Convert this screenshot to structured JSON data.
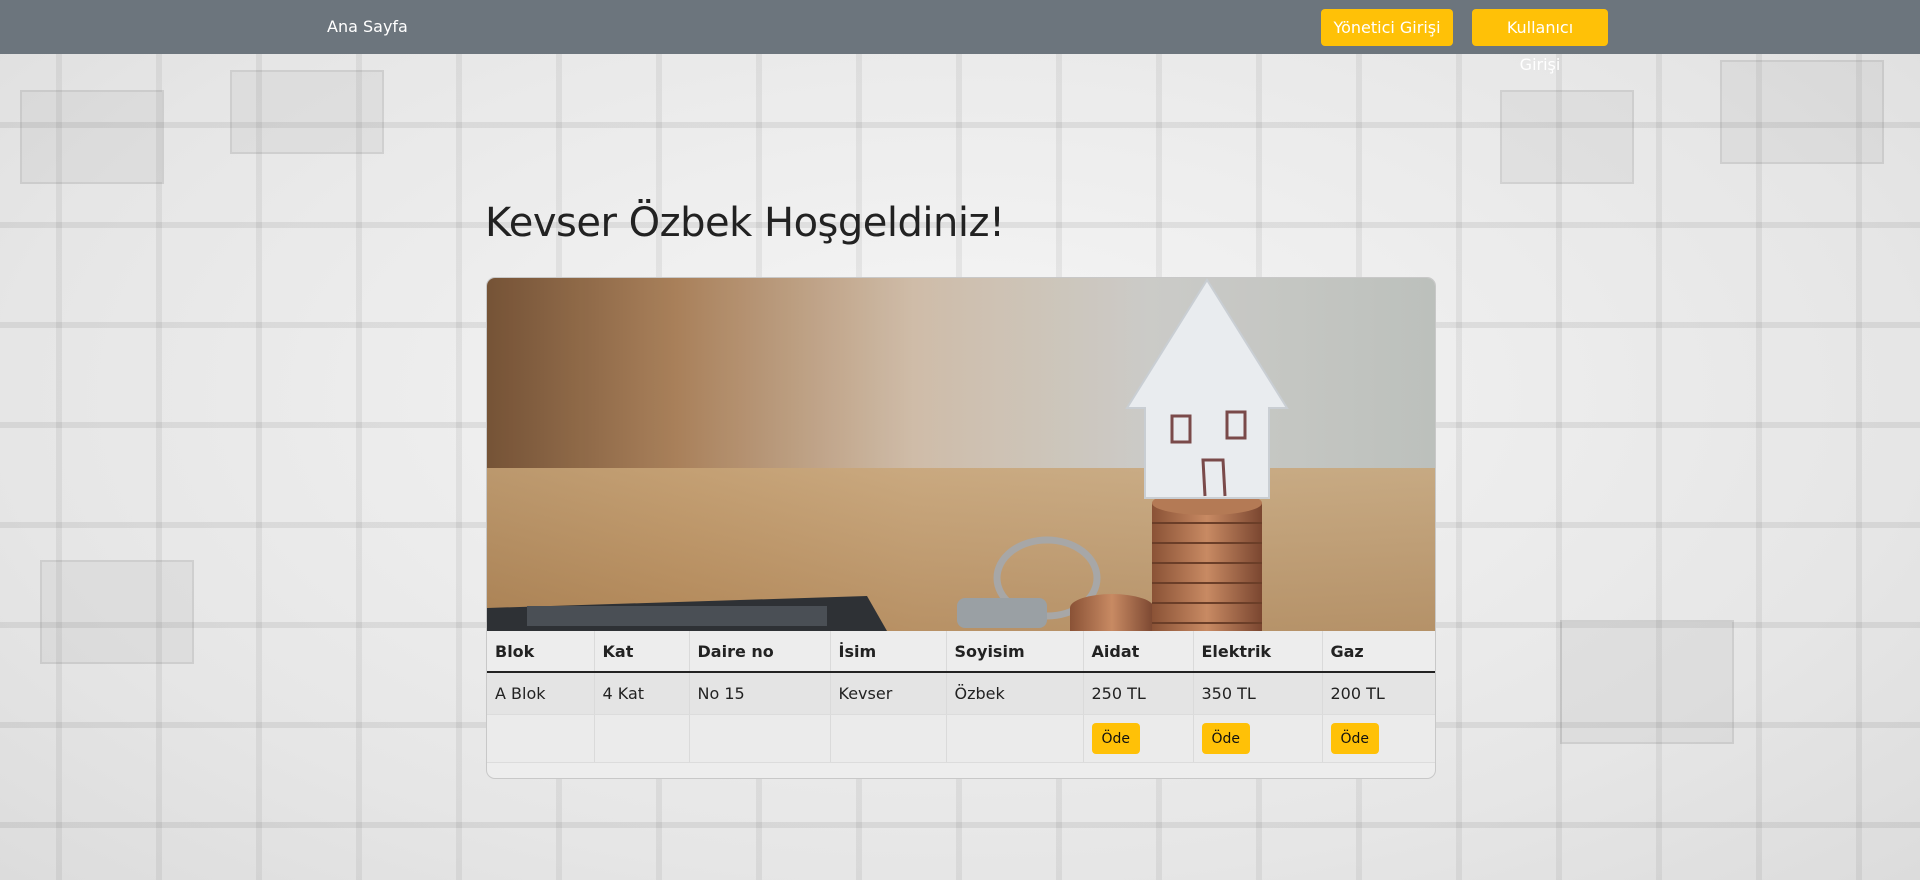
{
  "nav": {
    "home": "Ana Sayfa",
    "admin_login": "Yönetici Girişi",
    "user_login": "Kullanıcı Girişi"
  },
  "welcome": "Kevser Özbek Hoşgeldiniz!",
  "table": {
    "headers": [
      "Blok",
      "Kat",
      "Daire no",
      "İsim",
      "Soyisim",
      "Aidat",
      "Elektrik",
      "Gaz"
    ],
    "row": [
      "A Blok",
      "4 Kat",
      "No 15",
      "Kevser",
      "Özbek",
      "250 TL",
      "350 TL",
      "200 TL"
    ],
    "pay_label": "Öde"
  },
  "colors": {
    "navbar": "#6c757d",
    "accent": "#ffc107"
  }
}
